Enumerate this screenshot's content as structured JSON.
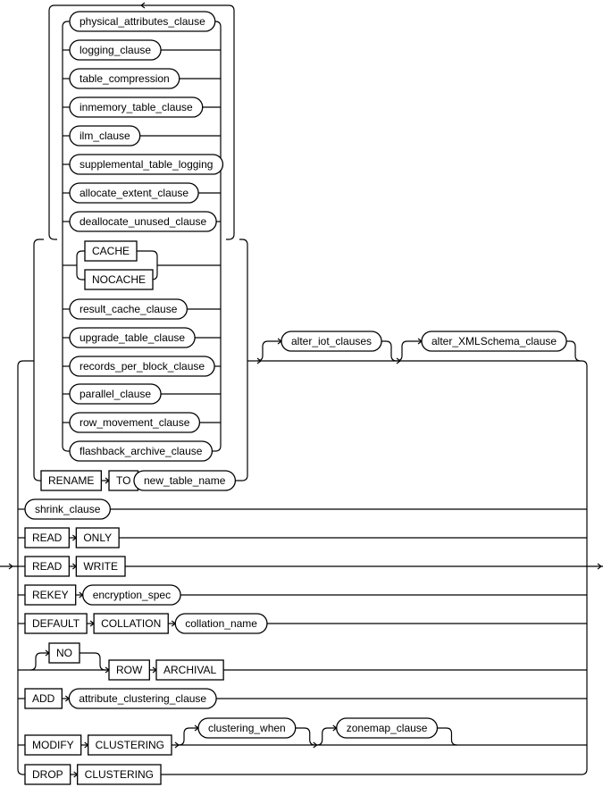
{
  "diagram": {
    "type": "railroad-syntax-diagram",
    "inner_loop_items": [
      {
        "label": "physical_attributes_clause",
        "kind": "nonterminal"
      },
      {
        "label": "logging_clause",
        "kind": "nonterminal"
      },
      {
        "label": "table_compression",
        "kind": "nonterminal"
      },
      {
        "label": "inmemory_table_clause",
        "kind": "nonterminal"
      },
      {
        "label": "ilm_clause",
        "kind": "nonterminal"
      },
      {
        "label": "supplemental_table_logging",
        "kind": "nonterminal"
      },
      {
        "label": "allocate_extent_clause",
        "kind": "nonterminal"
      },
      {
        "label": "deallocate_unused_clause",
        "kind": "nonterminal"
      },
      {
        "label": "CACHE",
        "kind": "keyword"
      },
      {
        "label": "NOCACHE",
        "kind": "keyword"
      },
      {
        "label": "result_cache_clause",
        "kind": "nonterminal"
      },
      {
        "label": "upgrade_table_clause",
        "kind": "nonterminal"
      },
      {
        "label": "records_per_block_clause",
        "kind": "nonterminal"
      },
      {
        "label": "parallel_clause",
        "kind": "nonterminal"
      },
      {
        "label": "row_movement_clause",
        "kind": "nonterminal"
      },
      {
        "label": "flashback_archive_clause",
        "kind": "nonterminal"
      }
    ],
    "rename": {
      "rename_kw": "RENAME",
      "to_kw": "TO",
      "name": "new_table_name"
    },
    "optional_tail": {
      "iot": "alter_iot_clauses",
      "xml": "alter_XMLSchema_clause"
    },
    "branches": {
      "shrink": "shrink_clause",
      "read_only": [
        "READ",
        "ONLY"
      ],
      "read_write": [
        "READ",
        "WRITE"
      ],
      "rekey": [
        "REKEY",
        "encryption_spec"
      ],
      "default_collation": [
        "DEFAULT",
        "COLLATION",
        "collation_name"
      ],
      "row_archival": [
        "NO",
        "ROW",
        "ARCHIVAL"
      ],
      "add": [
        "ADD",
        "attribute_clustering_clause"
      ],
      "modify": [
        "MODIFY",
        "CLUSTERING",
        "clustering_when",
        "zonemap_clause"
      ],
      "drop": [
        "DROP",
        "CLUSTERING"
      ]
    }
  }
}
